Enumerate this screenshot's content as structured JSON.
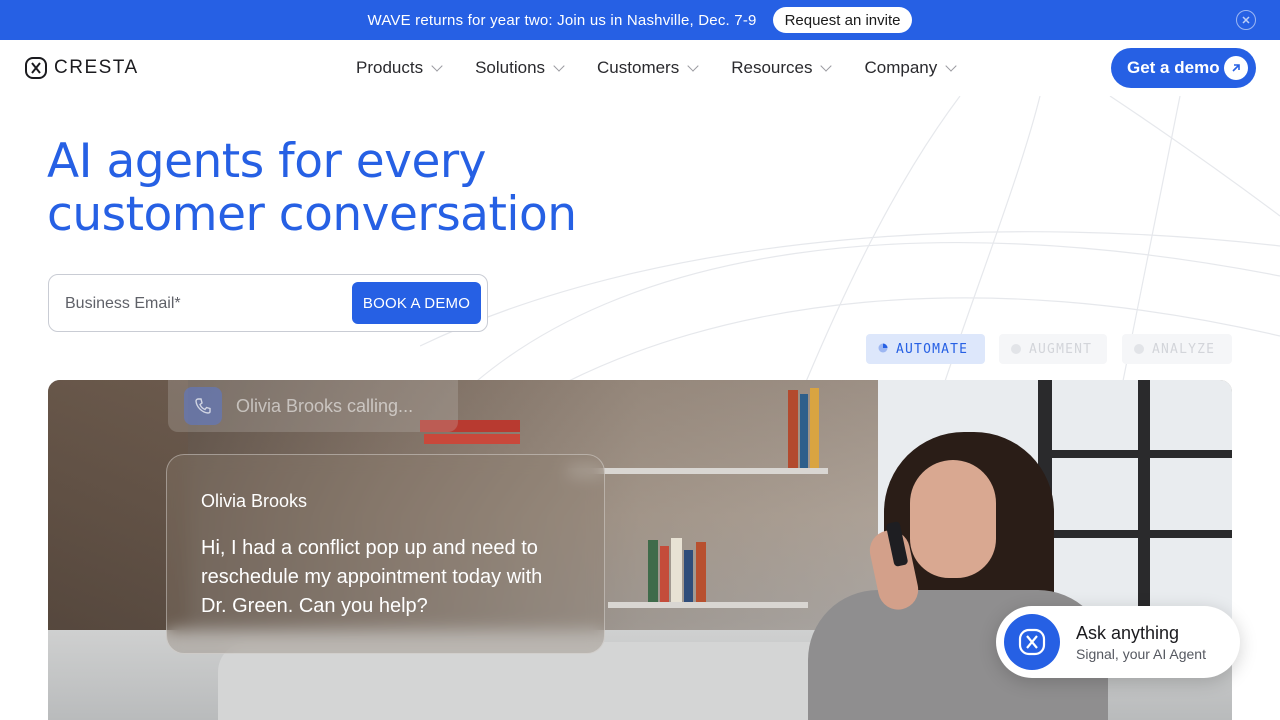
{
  "announcement": {
    "text": "WAVE returns for year two: Join us in Nashville, Dec. 7-9",
    "cta_label": "Request an invite",
    "close_icon": "close-circle-icon"
  },
  "brand": {
    "name": "CRESTA",
    "accent": "#2660e4"
  },
  "nav": {
    "items": [
      {
        "label": "Products"
      },
      {
        "label": "Solutions"
      },
      {
        "label": "Customers"
      },
      {
        "label": "Resources"
      },
      {
        "label": "Company"
      }
    ],
    "cta_label": "Get a demo"
  },
  "hero": {
    "title_line1": "AI agents for every",
    "title_line2": "customer conversation",
    "email_placeholder": "Business Email*",
    "book_label": "BOOK A DEMO"
  },
  "tabs": [
    {
      "label": "AUTOMATE",
      "active": true
    },
    {
      "label": "AUGMENT",
      "active": false
    },
    {
      "label": "ANALYZE",
      "active": false
    }
  ],
  "video": {
    "calling_text": "Olivia Brooks calling...",
    "caller_name": "Olivia Brooks",
    "message": "Hi, I had a conflict pop up and need to reschedule my appointment today with Dr. Green. Can you help?"
  },
  "assistant": {
    "title": "Ask anything",
    "subtitle": "Signal, your AI Agent"
  }
}
